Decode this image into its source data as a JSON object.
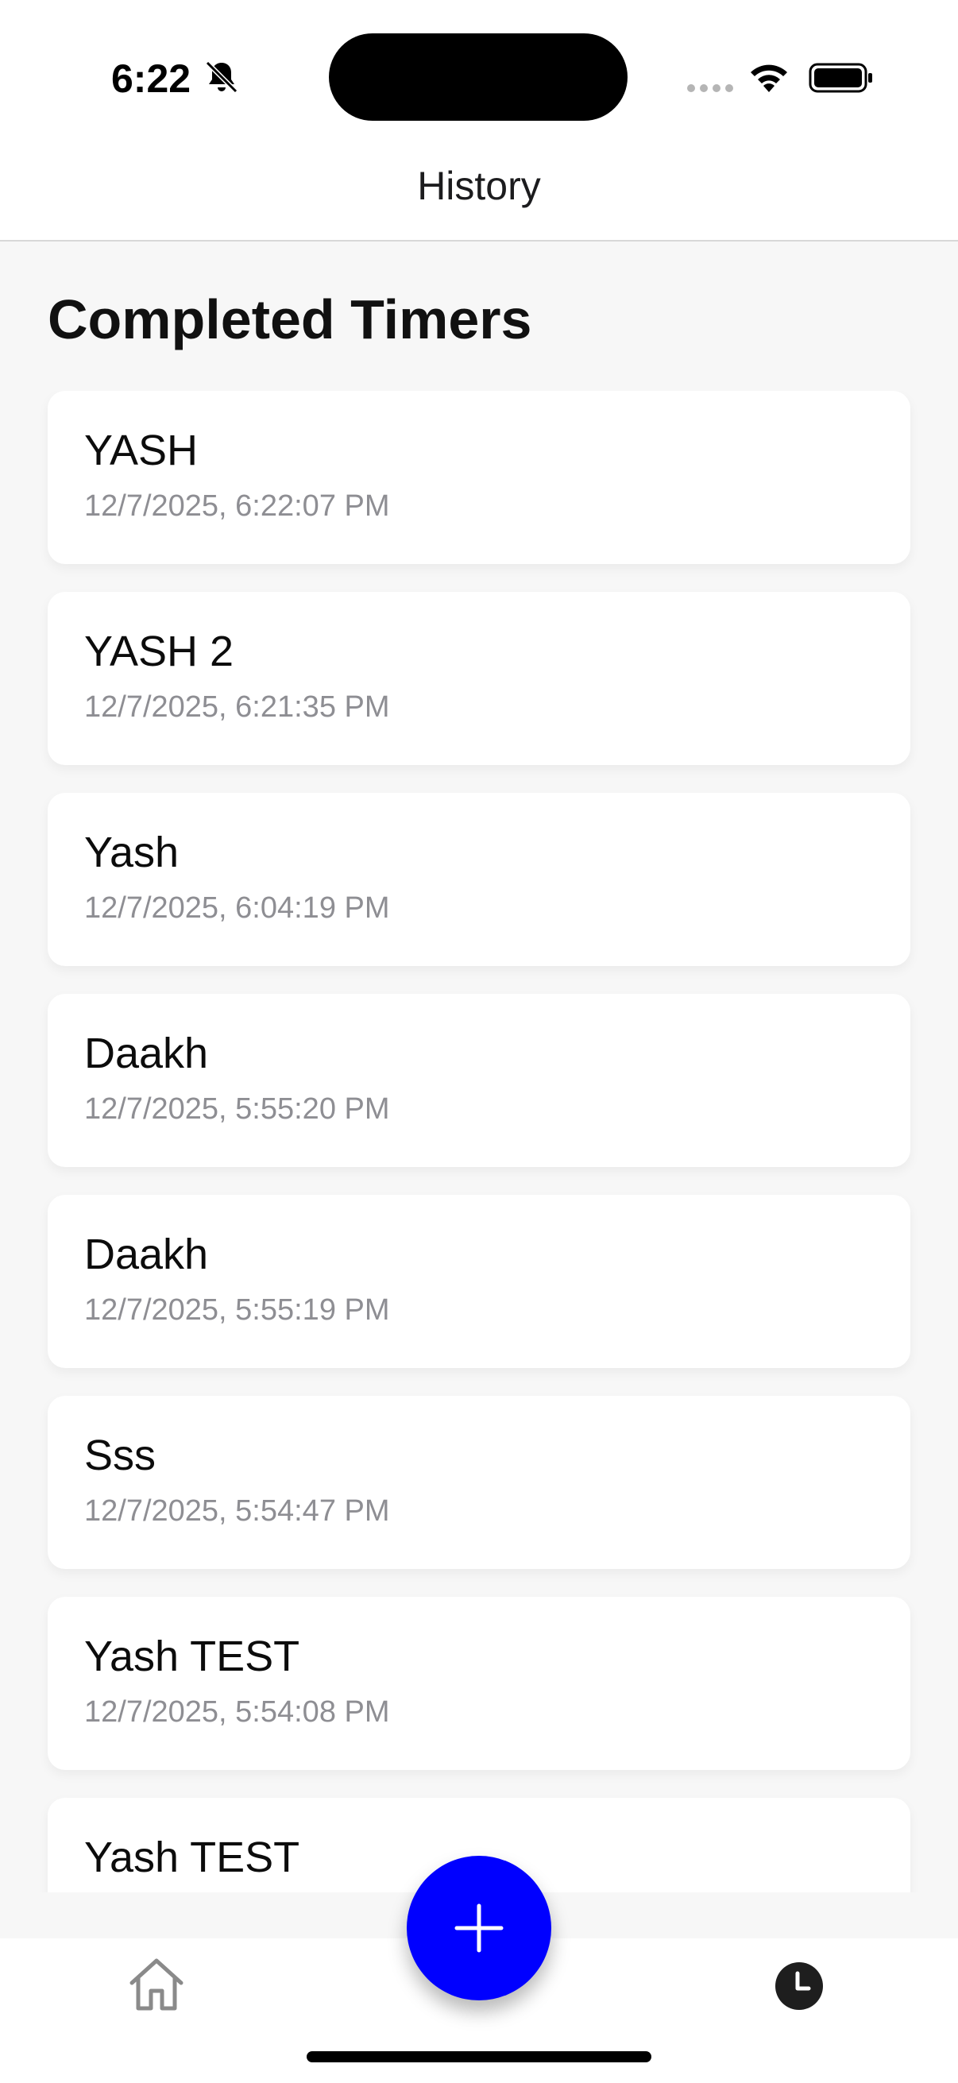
{
  "status_bar": {
    "time": "6:22",
    "icons": [
      "bell-slash-icon",
      "signal-dots-icon",
      "wifi-icon",
      "battery-icon"
    ]
  },
  "header": {
    "title": "History"
  },
  "section": {
    "title": "Completed Timers"
  },
  "timers": [
    {
      "name": "YASH",
      "completed_at": "12/7/2025, 6:22:07 PM"
    },
    {
      "name": "YASH 2",
      "completed_at": "12/7/2025, 6:21:35 PM"
    },
    {
      "name": "Yash",
      "completed_at": "12/7/2025, 6:04:19 PM"
    },
    {
      "name": "Daakh",
      "completed_at": "12/7/2025, 5:55:20 PM"
    },
    {
      "name": "Daakh",
      "completed_at": "12/7/2025, 5:55:19 PM"
    },
    {
      "name": "Sss",
      "completed_at": "12/7/2025, 5:54:47 PM"
    },
    {
      "name": "Yash TEST",
      "completed_at": "12/7/2025, 5:54:08 PM"
    },
    {
      "name": "Yash TEST",
      "completed_at": ""
    }
  ],
  "tabbar": {
    "left_icon": "home-icon",
    "center_icon": "plus-icon",
    "right_icon": "clock-icon",
    "accent_color": "#0000ff"
  }
}
